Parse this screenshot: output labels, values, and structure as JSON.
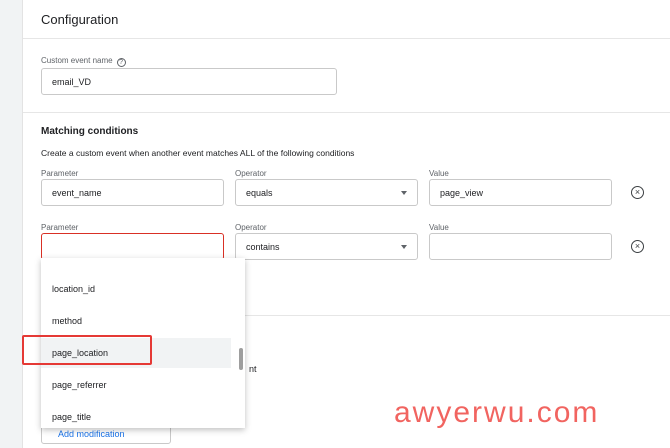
{
  "config": {
    "title": "Configuration",
    "custom_event_name_label": "Custom event name",
    "help_icon": "help-circle-icon",
    "custom_event_name_value": "email_VD"
  },
  "matching": {
    "title": "Matching conditions",
    "description": "Create a custom event when another event matches ALL of the following conditions",
    "rows": [
      {
        "parameter_label": "Parameter",
        "parameter_value": "event_name",
        "operator_label": "Operator",
        "operator_value": "equals",
        "value_label": "Value",
        "value_value": "page_view"
      },
      {
        "parameter_label": "Parameter",
        "parameter_value": "",
        "operator_label": "Operator",
        "operator_value": "contains",
        "value_label": "Value",
        "value_value": ""
      }
    ]
  },
  "dropdown": {
    "items": [
      "location_id",
      "method",
      "page_location",
      "page_referrer",
      "page_title"
    ],
    "hovered": "page_location"
  },
  "partial_text": "nt",
  "add_modification_label": "Add modification",
  "watermark": "awyerwu.com",
  "colors": {
    "accent": "#1a73e8",
    "error": "#d93025",
    "highlight": "#e53935"
  }
}
